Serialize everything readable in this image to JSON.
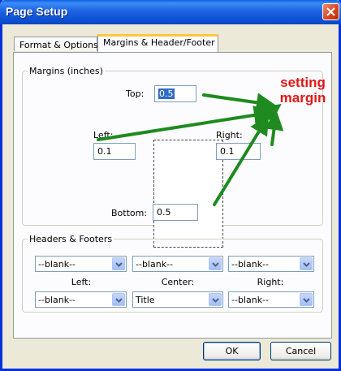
{
  "window": {
    "title": "Page Setup"
  },
  "tabs": [
    {
      "label": "Format & Options",
      "active": false
    },
    {
      "label": "Margins & Header/Footer",
      "active": true
    }
  ],
  "margins": {
    "legend": "Margins (inches)",
    "top_label": "Top:",
    "top_value": "0.5",
    "left_label": "Left:",
    "left_value": "0.1",
    "right_label": "Right:",
    "right_value": "0.1",
    "bottom_label": "Bottom:",
    "bottom_value": "0.5"
  },
  "headers_footers": {
    "legend": "Headers & Footers",
    "header_row": [
      "--blank--",
      "--blank--",
      "--blank--"
    ],
    "column_labels": [
      "Left:",
      "Center:",
      "Right:"
    ],
    "footer_row": [
      "--blank--",
      "Title",
      "--blank--"
    ]
  },
  "buttons": {
    "ok": "OK",
    "cancel": "Cancel"
  },
  "annotation": {
    "line1": "setting",
    "line2": "margin",
    "color": "#e01818",
    "arrow_color": "#1f8a1f"
  },
  "icons": {
    "close": "close-icon",
    "dropdown": "chevron-down-icon"
  }
}
